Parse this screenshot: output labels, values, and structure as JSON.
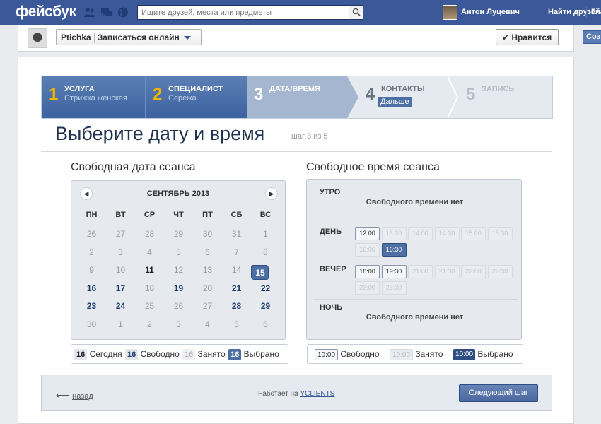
{
  "topbar": {
    "logo": "фейсбук",
    "search_placeholder": "Ищите друзей, места или предметы",
    "user_name": "Антон Луцевич",
    "find_friends": "Найти друзей",
    "home_partial": "Гла"
  },
  "pagebar": {
    "page_name": "Ptichka",
    "tab_label": "Записаться онлайн",
    "like_label": "✔ Нравится",
    "right_button": "Соз"
  },
  "steps": [
    {
      "num": "1",
      "title": "УСЛУГА",
      "sub": "Стрижка женская"
    },
    {
      "num": "2",
      "title": "СПЕЦИАЛИСТ",
      "sub": "Сережа"
    },
    {
      "num": "3",
      "title": "ДАТА/ВРЕМЯ",
      "sub": ""
    },
    {
      "num": "4",
      "title": "КОНТАКТЫ",
      "sub": ""
    },
    {
      "num": "5",
      "title": "ЗАПИСЬ",
      "sub": ""
    }
  ],
  "next_badge": "Дальше",
  "heading": "Выберите дату и время",
  "step_note": "шаг 3 из 5",
  "date_section_title": "Свободная дата сеанса",
  "time_section_title": "Свободное время сеанса",
  "calendar": {
    "month_label": "СЕНТЯБРЬ 2013",
    "weekdays": [
      "ПН",
      "ВТ",
      "СР",
      "ЧТ",
      "ПТ",
      "СБ",
      "ВС"
    ],
    "weeks": [
      [
        {
          "d": "26",
          "s": "muted"
        },
        {
          "d": "27",
          "s": "muted"
        },
        {
          "d": "28",
          "s": "muted"
        },
        {
          "d": "29",
          "s": "muted"
        },
        {
          "d": "30",
          "s": "muted"
        },
        {
          "d": "31",
          "s": "muted"
        },
        {
          "d": "1",
          "s": "norm"
        }
      ],
      [
        {
          "d": "2",
          "s": "norm"
        },
        {
          "d": "3",
          "s": "norm"
        },
        {
          "d": "4",
          "s": "norm"
        },
        {
          "d": "5",
          "s": "norm"
        },
        {
          "d": "6",
          "s": "norm"
        },
        {
          "d": "7",
          "s": "norm"
        },
        {
          "d": "8",
          "s": "norm"
        }
      ],
      [
        {
          "d": "9",
          "s": "norm"
        },
        {
          "d": "10",
          "s": "norm"
        },
        {
          "d": "11",
          "s": "today"
        },
        {
          "d": "12",
          "s": "norm"
        },
        {
          "d": "13",
          "s": "norm"
        },
        {
          "d": "14",
          "s": "norm"
        },
        {
          "d": "15",
          "s": "sel"
        }
      ],
      [
        {
          "d": "16",
          "s": "free"
        },
        {
          "d": "17",
          "s": "free"
        },
        {
          "d": "18",
          "s": "norm"
        },
        {
          "d": "19",
          "s": "free"
        },
        {
          "d": "20",
          "s": "norm"
        },
        {
          "d": "21",
          "s": "free"
        },
        {
          "d": "22",
          "s": "free"
        }
      ],
      [
        {
          "d": "23",
          "s": "free"
        },
        {
          "d": "24",
          "s": "free"
        },
        {
          "d": "25",
          "s": "norm"
        },
        {
          "d": "26",
          "s": "norm"
        },
        {
          "d": "27",
          "s": "norm"
        },
        {
          "d": "28",
          "s": "free"
        },
        {
          "d": "29",
          "s": "free"
        }
      ],
      [
        {
          "d": "30",
          "s": "norm"
        },
        {
          "d": "1",
          "s": "muted"
        },
        {
          "d": "2",
          "s": "muted"
        },
        {
          "d": "3",
          "s": "muted"
        },
        {
          "d": "4",
          "s": "muted"
        },
        {
          "d": "5",
          "s": "muted"
        },
        {
          "d": "6",
          "s": "muted"
        }
      ]
    ]
  },
  "date_legend": [
    {
      "badge": "16",
      "label": "Сегодня"
    },
    {
      "badge": "16",
      "label": "Свободно"
    },
    {
      "badge": "16",
      "label": "Занято"
    },
    {
      "badge": "16",
      "label": "Выбрано"
    }
  ],
  "times": {
    "no_free": "Свободного времени нет",
    "morning": {
      "label": "УТРО"
    },
    "day": {
      "label": "ДЕНЬ",
      "slots": [
        {
          "t": "12:00",
          "s": "av"
        },
        {
          "t": "13:30",
          "s": "busy"
        },
        {
          "t": "14:00",
          "s": "busy"
        },
        {
          "t": "14:30",
          "s": "busy"
        },
        {
          "t": "15:00",
          "s": "busy"
        },
        {
          "t": "15:30",
          "s": "busy"
        },
        {
          "t": "16:00",
          "s": "busy"
        },
        {
          "t": "16:30",
          "s": "sel"
        }
      ]
    },
    "evening": {
      "label": "ВЕЧЕР",
      "slots": [
        {
          "t": "18:00",
          "s": "av"
        },
        {
          "t": "19:30",
          "s": "av"
        },
        {
          "t": "21:00",
          "s": "busy"
        },
        {
          "t": "21:30",
          "s": "busy"
        },
        {
          "t": "22:00",
          "s": "busy"
        },
        {
          "t": "22:30",
          "s": "busy"
        },
        {
          "t": "23:00",
          "s": "busy"
        },
        {
          "t": "23:30",
          "s": "busy"
        }
      ]
    },
    "night": {
      "label": "НОЧЬ"
    }
  },
  "time_legend": [
    {
      "badge": "10:00",
      "label": "Свободно"
    },
    {
      "badge": "10:00",
      "label": "Занято"
    },
    {
      "badge": "10:00",
      "label": "Выбрано"
    }
  ],
  "footer": {
    "back_arrow": "⟵",
    "back_label": "назад",
    "powered_prefix": "Работает на",
    "powered_link": "YCLIENTS",
    "next_button": "Следующий шаг"
  }
}
